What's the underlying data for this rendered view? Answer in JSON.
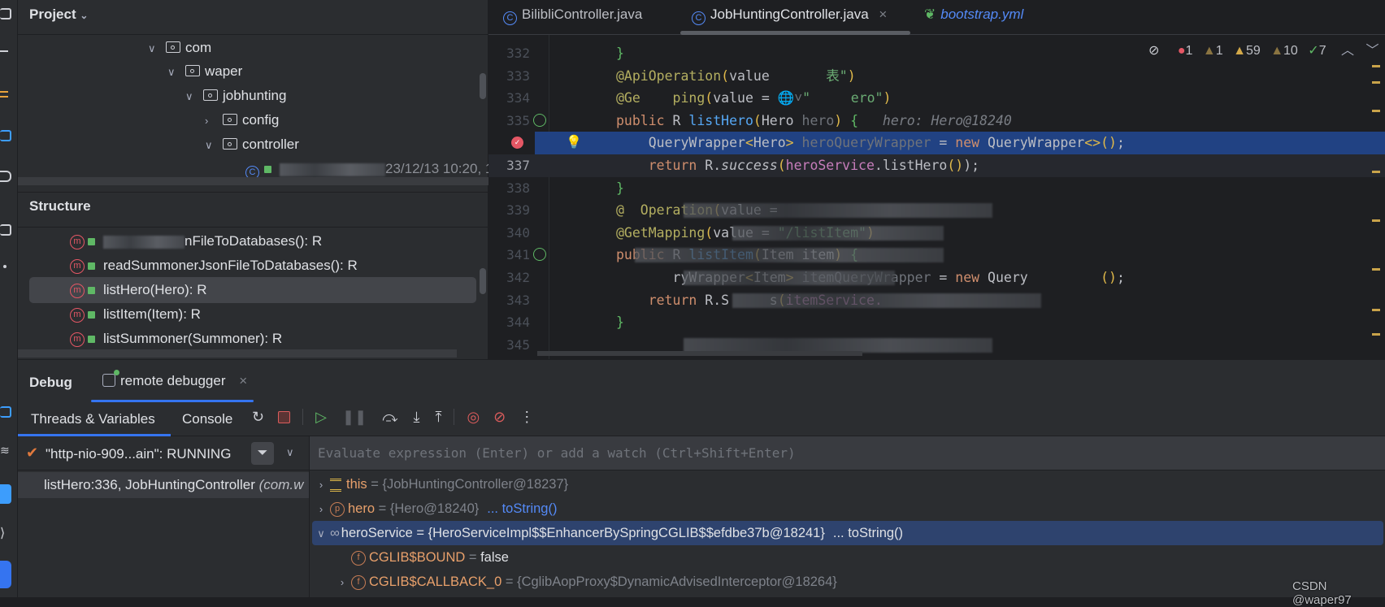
{
  "project_panel": {
    "title": "Project",
    "tree": [
      {
        "label": "com",
        "expanded": true,
        "depth": 0
      },
      {
        "label": "waper",
        "expanded": true,
        "depth": 1
      },
      {
        "label": "jobhunting",
        "expanded": true,
        "depth": 2
      },
      {
        "label": "config",
        "expanded": false,
        "depth": 3
      },
      {
        "label": "controller",
        "expanded": true,
        "depth": 3
      }
    ],
    "partial_file_meta": "23/12/13 10:20, 1"
  },
  "structure_panel": {
    "title": "Structure",
    "items": [
      {
        "label": "nFileToDatabases(): R",
        "obscured": true
      },
      {
        "label": "readSummonerJsonFileToDatabases(): R"
      },
      {
        "label": "listHero(Hero): R",
        "selected": true
      },
      {
        "label": "listItem(Item): R"
      },
      {
        "label": "listSummoner(Summoner): R"
      }
    ]
  },
  "editor": {
    "tabs": [
      {
        "label": "BilibliController.java",
        "icon": "class-icon"
      },
      {
        "label": "JobHuntingController.java",
        "icon": "class-icon",
        "active": true,
        "close": "×"
      },
      {
        "label": "bootstrap.yml",
        "icon": "spring-yml-icon"
      }
    ],
    "inspections": {
      "errors": "1",
      "warnings_dark": "1",
      "warnings": "59",
      "weak_warnings": "10",
      "typos": "7"
    },
    "current_line": "337",
    "lines": [
      {
        "num": "332",
        "tokens": [
          {
            "t": "}",
            "k": "gr"
          }
        ]
      },
      {
        "num": "333",
        "tokens": [
          {
            "t": "@ApiOperation",
            "k": "an"
          },
          {
            "t": "(",
            "k": "br"
          },
          {
            "t": "value ",
            "k": "pl"
          },
          {
            "t": "      表\"",
            "k": "str"
          },
          {
            "t": ")",
            "k": "br"
          }
        ]
      },
      {
        "num": "334",
        "tokens": [
          {
            "t": "@Ge    ping",
            "k": "an"
          },
          {
            "t": "(",
            "k": "br"
          },
          {
            "t": "value = ",
            "k": "pl"
          },
          {
            "t": "🌐˅",
            "k": "dim"
          },
          {
            "t": "\"     ero\"",
            "k": "str"
          },
          {
            "t": ")",
            "k": "br"
          }
        ]
      },
      {
        "num": "335",
        "tokens": [
          {
            "t": "public ",
            "k": "kw"
          },
          {
            "t": "R ",
            "k": "pl"
          },
          {
            "t": "listHero",
            "k": "fn"
          },
          {
            "t": "(",
            "k": "br"
          },
          {
            "t": "Hero ",
            "k": "pl"
          },
          {
            "t": "hero",
            "k": "dim"
          },
          {
            "t": ") ",
            "k": "br"
          },
          {
            "t": "{   ",
            "k": "gr"
          },
          {
            "t": "hero: Hero@18240",
            "k": "hint"
          }
        ]
      },
      {
        "num": "",
        "breakpoint": true,
        "tokens": [
          {
            "t": "    QueryWrapper",
            "k": "pl"
          },
          {
            "t": "<",
            "k": "br"
          },
          {
            "t": "Hero",
            "k": "pl"
          },
          {
            "t": "> ",
            "k": "br"
          },
          {
            "t": "heroQueryWrapper",
            "k": "dim"
          },
          {
            "t": " = ",
            "k": "pl"
          },
          {
            "t": "new ",
            "k": "kw"
          },
          {
            "t": "QueryWrapper",
            "k": "pl"
          },
          {
            "t": "<>()",
            "k": "br"
          },
          {
            "t": ";",
            "k": "pl"
          }
        ]
      },
      {
        "num": "337",
        "tokens": [
          {
            "t": "    return ",
            "k": "kw"
          },
          {
            "t": "R.",
            "k": "pl"
          },
          {
            "t": "success",
            "k": "it"
          },
          {
            "t": "(",
            "k": "br"
          },
          {
            "t": "heroService",
            "k": "field"
          },
          {
            "t": ".listHero",
            "k": "pl"
          },
          {
            "t": "()",
            "k": "br"
          },
          {
            "t": ");",
            "k": "pl"
          }
        ]
      },
      {
        "num": "338",
        "tokens": [
          {
            "t": "}",
            "k": "gr"
          }
        ]
      },
      {
        "num": "339",
        "obscured": true,
        "tokens": [
          {
            "t": "@  Operation",
            "k": "an"
          },
          {
            "t": "(",
            "k": "br"
          },
          {
            "t": "value = ",
            "k": "pl"
          }
        ]
      },
      {
        "num": "340",
        "obscured": true,
        "tokens": [
          {
            "t": "@GetMapping",
            "k": "an"
          },
          {
            "t": "(",
            "k": "br"
          },
          {
            "t": "value = ",
            "k": "pl"
          },
          {
            "t": "\"/listItem\"",
            "k": "str"
          },
          {
            "t": ")",
            "k": "br"
          }
        ]
      },
      {
        "num": "341",
        "obscured": true,
        "tokens": [
          {
            "t": "public ",
            "k": "kw"
          },
          {
            "t": "R ",
            "k": "pl"
          },
          {
            "t": "listItem",
            "k": "fn"
          },
          {
            "t": "(",
            "k": "br"
          },
          {
            "t": "Item item",
            "k": "pl"
          },
          {
            "t": ") ",
            "k": "br"
          },
          {
            "t": "{",
            "k": "gr"
          }
        ]
      },
      {
        "num": "342",
        "obscured": true,
        "tokens": [
          {
            "t": "       ryWrapper",
            "k": "pl"
          },
          {
            "t": "<",
            "k": "br"
          },
          {
            "t": "Item",
            "k": "pl"
          },
          {
            "t": "> ",
            "k": "br"
          },
          {
            "t": "itemQueryWrapper",
            "k": "dim"
          },
          {
            "t": " = ",
            "k": "pl"
          },
          {
            "t": "new ",
            "k": "kw"
          },
          {
            "t": "Query         ",
            "k": "pl"
          },
          {
            "t": "()",
            "k": "br"
          },
          {
            "t": ";",
            "k": "pl"
          }
        ]
      },
      {
        "num": "343",
        "obscured": true,
        "tokens": [
          {
            "t": "    return ",
            "k": "kw"
          },
          {
            "t": "R.S     s",
            "k": "pl"
          },
          {
            "t": "(",
            "k": "br"
          },
          {
            "t": "itemService.",
            "k": "field"
          }
        ]
      },
      {
        "num": "344",
        "tokens": [
          {
            "t": "}",
            "k": "gr"
          }
        ]
      },
      {
        "num": "345",
        "obscured": true,
        "tokens": []
      }
    ]
  },
  "debug": {
    "title": "Debug",
    "session_tab": "remote debugger",
    "close": "×",
    "tabs": [
      "Threads & Variables",
      "Console"
    ],
    "thread": "\"http-nio-909...ain\": RUNNING",
    "frame": "listHero:336, JobHuntingController",
    "frame_pkg": "(com.w",
    "eval_placeholder": "Evaluate expression (Enter) or add a watch (Ctrl+Shift+Enter)",
    "variables": [
      {
        "name": "this",
        "eq": " = ",
        "value": "{JobHuntingController@18237}",
        "icon": "static-icon",
        "expandable": true
      },
      {
        "name": "hero",
        "eq": " = ",
        "value": "{Hero@18240}",
        "link": "... toString()",
        "icon": "p",
        "expandable": true
      },
      {
        "name": "heroService",
        "eq": " = ",
        "value": "{HeroServiceImpl$$EnhancerBySpringCGLIB$$efdbe37b@18241}",
        "link": "... toString()",
        "icon": "oo",
        "expanded": true,
        "selected": true
      },
      {
        "name": "CGLIB$BOUND",
        "eq": " = ",
        "value": "false",
        "icon": "f",
        "child": true
      },
      {
        "name": "CGLIB$CALLBACK_0",
        "eq": " = ",
        "value": "{CglibAopProxy$DynamicAdvisedInterceptor@18264}",
        "icon": "f",
        "child": true,
        "expandable": true
      }
    ]
  },
  "watermark": "CSDN @waper97",
  "colors": {
    "accent": "#3574f0",
    "selection": "#2e436e",
    "exec_line": "#214283",
    "error": "#e55765",
    "warning": "#d3a949"
  }
}
